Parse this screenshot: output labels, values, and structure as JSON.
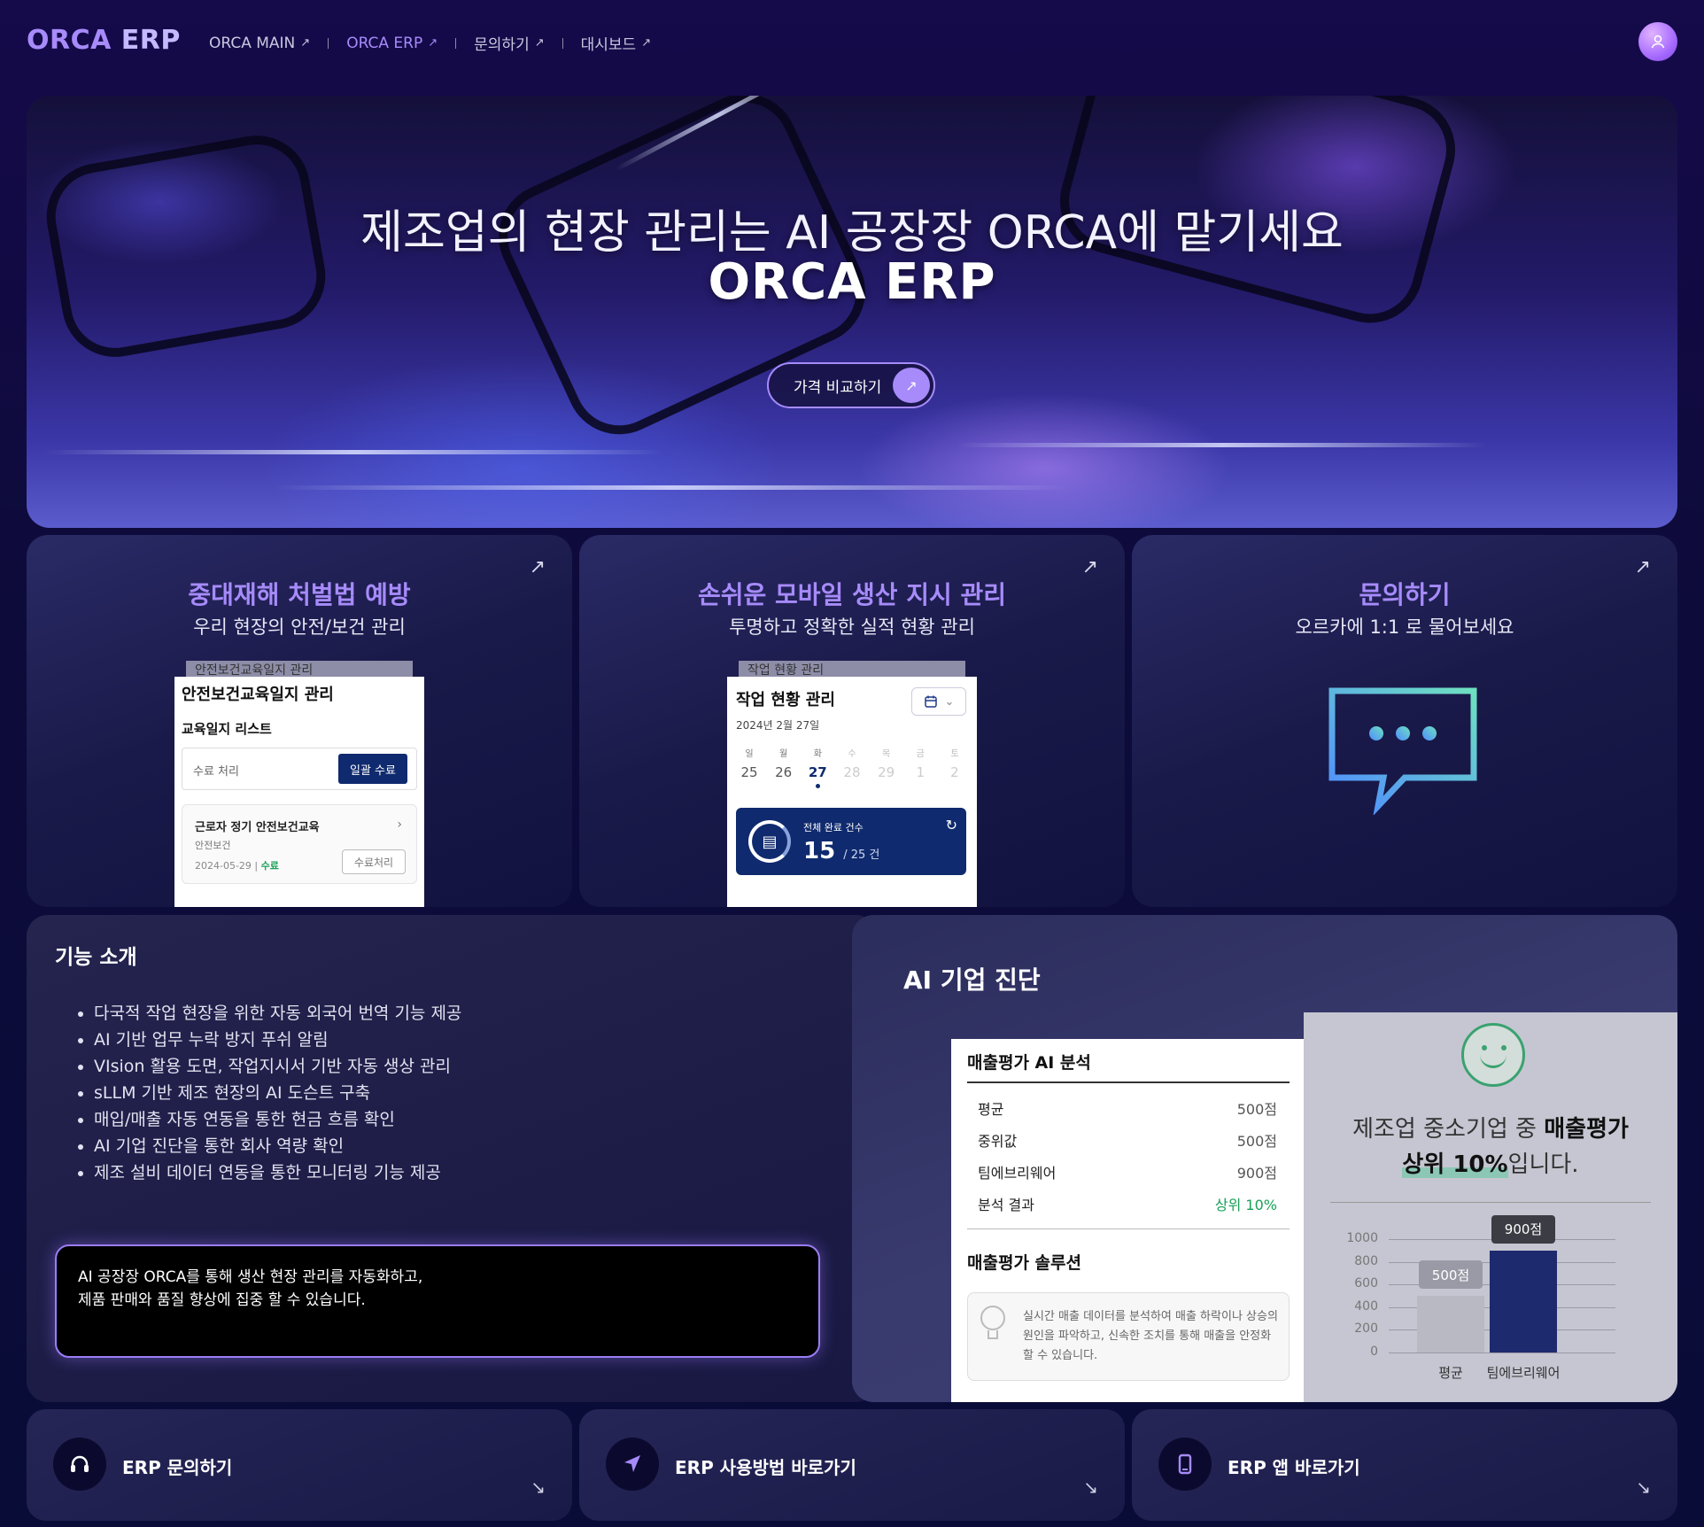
{
  "nav": {
    "logo_part1": "ORCA",
    "logo_part2": "ERP",
    "items": [
      {
        "label": "ORCA MAIN",
        "arrow": "↗"
      },
      {
        "label": "ORCA ERP",
        "arrow": "↗"
      },
      {
        "label": "문의하기",
        "arrow": "↗"
      },
      {
        "label": "대시보드",
        "arrow": "↗"
      }
    ],
    "active_index": 1
  },
  "hero": {
    "title_line1": "제조업의 현장 관리는 AI 공장장 ORCA에 맡기세요",
    "title_line2": "ORCA ERP",
    "button_label": "가격 비교하기",
    "button_arrow": "↗"
  },
  "cards": [
    {
      "title": "중대재해 처벌법 예방",
      "subtitle": "우리 현장의 안전/보건 관리",
      "corner_arrow": "↗",
      "mock": {
        "tab": "안전보건교육일지 관리",
        "heading": "안전보건교육일지 관리",
        "list_title": "교육일지 리스트",
        "input_placeholder": "수료 처리",
        "bulk_button": "일괄 수료",
        "row_title": "근로자 정기 안전보건교육",
        "row_category": "안전보건",
        "row_date": "2024-05-29",
        "row_status": "수료",
        "row_button": "수료처리"
      }
    },
    {
      "title": "손쉬운 모바일 생산 지시 관리",
      "subtitle": "투명하고 정확한 실적 현황 관리",
      "corner_arrow": "↗",
      "mock": {
        "tab": "작업 현황 관리",
        "heading": "작업 현황 관리",
        "date": "2024년 2월 27일",
        "days": [
          {
            "w": "일",
            "n": "25",
            "state": "normal"
          },
          {
            "w": "월",
            "n": "26",
            "state": "normal"
          },
          {
            "w": "화",
            "n": "27",
            "state": "on"
          },
          {
            "w": "수",
            "n": "28",
            "state": "dim"
          },
          {
            "w": "목",
            "n": "29",
            "state": "dim"
          },
          {
            "w": "금",
            "n": "1",
            "state": "dim"
          },
          {
            "w": "토",
            "n": "2",
            "state": "dim"
          }
        ],
        "panel_label": "전체 완료 건수",
        "panel_done": "15",
        "panel_total": "/ 25 건"
      }
    },
    {
      "title": "문의하기",
      "subtitle": "오르카에 1:1 로 물어보세요",
      "corner_arrow": "↗"
    }
  ],
  "features": {
    "heading": "기능 소개",
    "items": [
      "다국적 작업 현장을 위한 자동 외국어 번역 기능 제공",
      "AI 기반 업무 누락 방지 푸쉬 알림",
      "VIsion 활용 도면, 작업지시서 기반 자동 생상 관리",
      "sLLM 기반 제조 현장의 AI 도슨트 구축",
      "매입/매출 자동 연동을 통한 현금 흐름 확인",
      "AI 기업 진단을 통한 회사 역량 확인",
      "제조 설비 데이터 연동을 통한 모니터링 기능 제공"
    ],
    "quote_line1": "AI 공장장 ORCA를 통해 생산 현장 관리를 자동화하고,",
    "quote_line2": "제품 판매와 품질 향상에 집중 할 수 있습니다."
  },
  "ai_diagnosis": {
    "heading": "AI 기업 진단",
    "analysis_title": "매출평가 AI 분석",
    "rows": [
      {
        "label": "평균",
        "value": "500점",
        "highlight": false
      },
      {
        "label": "중위값",
        "value": "500점",
        "highlight": false
      },
      {
        "label": "팀에브리웨어",
        "value": "900점",
        "highlight": false
      },
      {
        "label": "분석 결과",
        "value": "상위 10%",
        "highlight": true
      }
    ],
    "solution_title": "매출평가 솔루션",
    "solution_text": "실시간 매출 데이터를 분석하여 매출 하락이나 상승의 원인을 파악하고, 신속한 조치를 통해 매출을 안정화할 수 있습니다.",
    "message_part1": "제조업 중소기업 중 ",
    "message_bold": "매출평가",
    "message_highlight": "상위 10%",
    "message_part2": "입니다.",
    "icon": "smile-icon"
  },
  "chart_data": {
    "type": "bar",
    "categories": [
      "평균",
      "팀에브리웨어"
    ],
    "values": [
      500,
      900
    ],
    "value_labels": [
      "500점",
      "900점"
    ],
    "yticks": [
      1000,
      800,
      600,
      400,
      200,
      0
    ],
    "ylim": [
      0,
      1000
    ],
    "colors": [
      "#b9b9c4",
      "#1e2a6e"
    ],
    "tooltip_colors": [
      "#9a9aa6",
      "#3c3c44"
    ],
    "title": "",
    "xlabel": "",
    "ylabel": ""
  },
  "links": [
    {
      "label": "ERP 문의하기",
      "icon": "headphones-icon",
      "arrow": "↘"
    },
    {
      "label": "ERP 사용방법 바로가기",
      "icon": "send-icon",
      "arrow": "↘"
    },
    {
      "label": "ERP 앱 바로가기",
      "icon": "phone-icon",
      "arrow": "↘"
    }
  ]
}
